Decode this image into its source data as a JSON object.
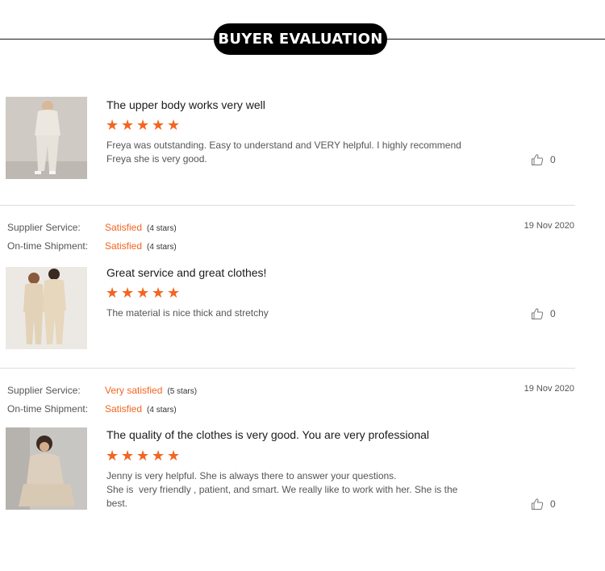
{
  "header": {
    "title": "BUYER EVALUATION"
  },
  "colors": {
    "accent": "#f26522",
    "pill": "#000000"
  },
  "reviews": [
    {
      "title": "The upper body works very well",
      "rating": 5,
      "body_lines": [
        "Freya was outstanding. Easy to understand and VERY helpful. I highly recommend",
        "Freya she is very good."
      ],
      "likes": "0",
      "icons": {
        "like": "thumbs-up-icon",
        "star": "star-icon"
      }
    },
    {
      "supplier_label": "Supplier Service:",
      "supplier_value": "Satisfied",
      "supplier_stars": "(4 stars)",
      "shipment_label": "On-time Shipment:",
      "shipment_value": "Satisfied",
      "shipment_stars": "(4 stars)",
      "date": "19 Nov 2020",
      "title": "Great service and great clothes!",
      "rating": 5,
      "body_lines": [
        "The material is nice thick and stretchy"
      ],
      "likes": "0"
    },
    {
      "supplier_label": "Supplier Service:",
      "supplier_value": "Very satisfied",
      "supplier_stars": "(5 stars)",
      "shipment_label": "On-time Shipment:",
      "shipment_value": "Satisfied",
      "shipment_stars": "(4 stars)",
      "date": "19 Nov 2020",
      "title": "The quality of the clothes is very good. You are very professional",
      "rating": 5,
      "body_lines": [
        "Jenny is very helpful. She is always there to answer your questions.",
        "She is  very friendly , patient, and smart. We really like to work with her. She is the",
        "best."
      ],
      "likes": "0"
    }
  ]
}
